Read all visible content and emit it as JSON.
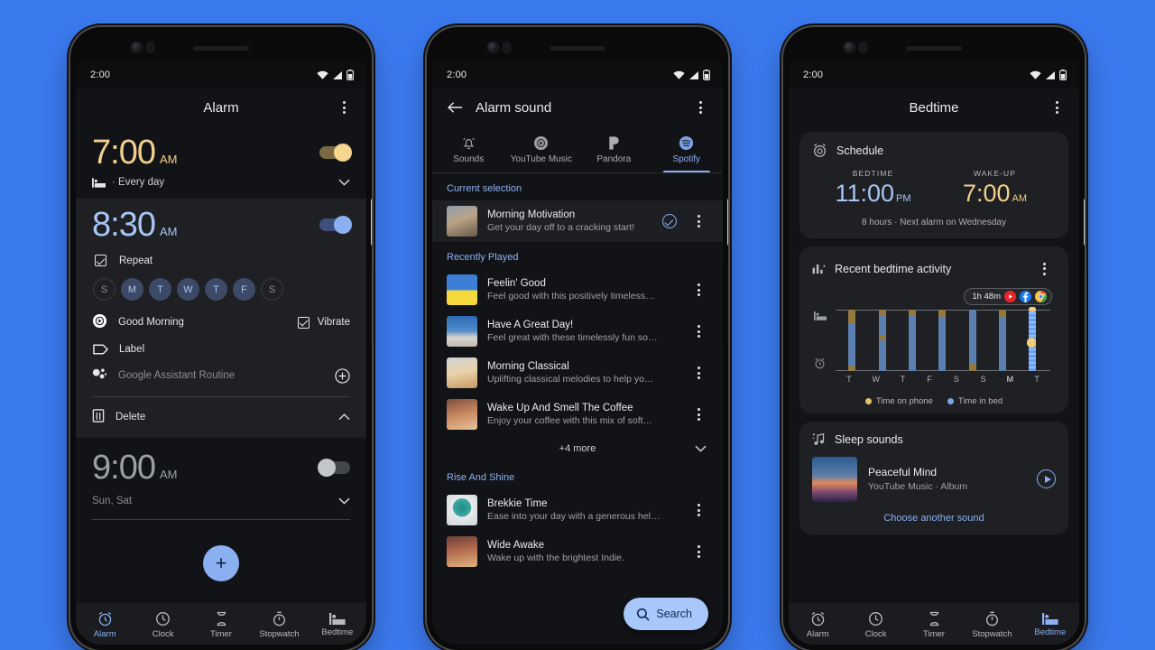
{
  "background_color": "#3b7bf0",
  "status_bar": {
    "time": "2:00",
    "icons": [
      "wifi-icon",
      "signal-icon",
      "battery-icon"
    ]
  },
  "phone1": {
    "appbar": {
      "title": "Alarm",
      "overflow": "overflow-menu-icon"
    },
    "alarms": [
      {
        "time": "7:00",
        "ampm": "AM",
        "enabled": true,
        "accent": "#f2d08c",
        "schedule_icon": "bed-icon",
        "schedule": "·  Every day",
        "expand": "chevron-down-icon"
      },
      {
        "time": "8:30",
        "ampm": "AM",
        "enabled": true,
        "accent": "#a7c5f5",
        "repeat_label": "Repeat",
        "days": [
          {
            "letter": "S",
            "on": false
          },
          {
            "letter": "M",
            "on": true
          },
          {
            "letter": "T",
            "on": true
          },
          {
            "letter": "W",
            "on": true
          },
          {
            "letter": "T",
            "on": true
          },
          {
            "letter": "F",
            "on": true
          },
          {
            "letter": "S",
            "on": false
          }
        ],
        "ringtone": "Good Morning",
        "vibrate_label": "Vibrate",
        "vibrate_on": true,
        "label_row": "Label",
        "assistant_row": "Google Assistant Routine",
        "assistant_add": "plus-circle-icon",
        "delete_label": "Delete",
        "collapse": "chevron-up-icon"
      },
      {
        "time": "9:00",
        "ampm": "AM",
        "enabled": false,
        "accent": "#9aa0a6",
        "schedule": "Sun, Sat",
        "expand": "chevron-down-icon"
      }
    ],
    "fab": "+",
    "nav": [
      {
        "label": "Alarm",
        "icon": "alarm-icon",
        "active": true
      },
      {
        "label": "Clock",
        "icon": "clock-icon",
        "active": false
      },
      {
        "label": "Timer",
        "icon": "hourglass-icon",
        "active": false
      },
      {
        "label": "Stopwatch",
        "icon": "stopwatch-icon",
        "active": false
      },
      {
        "label": "Bedtime",
        "icon": "bed-icon",
        "active": false
      }
    ]
  },
  "phone2": {
    "appbar": {
      "back": "back-arrow-icon",
      "title": "Alarm sound",
      "overflow": "overflow-menu-icon"
    },
    "tabs": [
      {
        "label": "Sounds",
        "icon": "bell-icon",
        "active": false
      },
      {
        "label": "YouTube Music",
        "icon": "youtube-music-icon",
        "active": false
      },
      {
        "label": "Pandora",
        "icon": "pandora-icon",
        "active": false
      },
      {
        "label": "Spotify",
        "icon": "spotify-icon",
        "active": true
      }
    ],
    "sections": [
      {
        "heading": "Current selection",
        "items": [
          {
            "title": "Morning Motivation",
            "desc": "Get your day off to a cracking start!",
            "selected": true,
            "art": "art-morning-motivation"
          }
        ]
      },
      {
        "heading": "Recently Played",
        "items": [
          {
            "title": "Feelin' Good",
            "desc": "Feel good with this positively timeless…",
            "art": "art-feelin-good"
          },
          {
            "title": "Have A Great Day!",
            "desc": "Feel great with these timelessly fun so…",
            "art": "art-have-a-great-day"
          },
          {
            "title": "Morning Classical",
            "desc": "Uplifting classical melodies to help yo…",
            "art": "art-morning-classical"
          },
          {
            "title": "Wake Up And Smell The Coffee",
            "desc": "Enjoy your coffee with this mix of soft…",
            "art": "art-wake-up-coffee"
          }
        ],
        "more": "+4 more"
      },
      {
        "heading": "Rise And Shine",
        "items": [
          {
            "title": "Brekkie Time",
            "desc": "Ease into your day with a generous hel…",
            "art": "art-brekkie-time"
          },
          {
            "title": "Wide Awake",
            "desc": "Wake up with the brightest Indie.",
            "art": "art-wide-awake"
          }
        ]
      }
    ],
    "search_fab": {
      "label": "Search",
      "icon": "search-icon"
    }
  },
  "phone3": {
    "appbar": {
      "title": "Bedtime",
      "overflow": "overflow-menu-icon"
    },
    "schedule": {
      "title": "Schedule",
      "icon": "alarm-icon",
      "bedtime_label": "BEDTIME",
      "bedtime_value": "11:00",
      "bedtime_ampm": "PM",
      "wake_label": "WAKE-UP",
      "wake_value": "7:00",
      "wake_ampm": "AM",
      "note": "8 hours · Next alarm on Wednesday"
    },
    "activity": {
      "title": "Recent bedtime activity",
      "icon": "bar-chart-icon",
      "overflow": "overflow-menu-icon",
      "badge": {
        "duration": "1h 48m",
        "apps": [
          "youtube-icon",
          "facebook-icon",
          "chrome-icon"
        ]
      }
    },
    "sleep_sounds": {
      "title": "Sleep  sounds",
      "icon": "music-note-icon",
      "track_title": "Peaceful Mind",
      "track_sub": "YouTube Music · Album",
      "play": "play-circle-icon",
      "choose": "Choose another sound"
    },
    "nav": [
      {
        "label": "Alarm",
        "icon": "alarm-icon",
        "active": false
      },
      {
        "label": "Clock",
        "icon": "clock-icon",
        "active": false
      },
      {
        "label": "Timer",
        "icon": "hourglass-icon",
        "active": false
      },
      {
        "label": "Stopwatch",
        "icon": "stopwatch-icon",
        "active": false
      },
      {
        "label": "Bedtime",
        "icon": "bed-icon",
        "active": true
      }
    ]
  },
  "chart_data": {
    "type": "bar",
    "title": "Recent bedtime activity",
    "categories": [
      "T",
      "W",
      "T",
      "F",
      "S",
      "S",
      "M",
      "T"
    ],
    "xlabel": "",
    "ylabel": "",
    "legend": [
      {
        "name": "Time on phone",
        "color": "#e8c16a"
      },
      {
        "name": "Time in bed",
        "color": "#7aa7e8"
      }
    ],
    "legend_position": "bottom-center",
    "grid": false,
    "note": "Vertical bars spanning bedtime (top) to wake-up (bottom); amber segments mark phone use.",
    "bars": [
      {
        "day": "T",
        "x_pct": 6,
        "in_bed_top_pct": 0,
        "in_bed_bottom_pct": 100,
        "phone_segments": [
          [
            0,
            22
          ],
          [
            92,
            100
          ]
        ]
      },
      {
        "day": "W",
        "x_pct": 20,
        "in_bed_top_pct": 3,
        "in_bed_bottom_pct": 100,
        "phone_segments": [
          [
            0,
            11
          ],
          [
            41,
            51
          ]
        ]
      },
      {
        "day": "T",
        "x_pct": 34,
        "in_bed_top_pct": 4,
        "in_bed_bottom_pct": 100,
        "phone_segments": [
          [
            0,
            9
          ]
        ]
      },
      {
        "day": "F",
        "x_pct": 48,
        "in_bed_top_pct": 3,
        "in_bed_bottom_pct": 100,
        "phone_segments": [
          [
            0,
            12
          ]
        ]
      },
      {
        "day": "S",
        "x_pct": 62,
        "in_bed_top_pct": 0,
        "in_bed_bottom_pct": 100,
        "phone_segments": [
          [
            88,
            100
          ]
        ]
      },
      {
        "day": "S",
        "x_pct": 76,
        "in_bed_top_pct": 3,
        "in_bed_bottom_pct": 100,
        "phone_segments": [
          [
            0,
            12
          ]
        ]
      },
      {
        "day": "M",
        "x_pct": 90,
        "in_bed_top_pct": 0,
        "in_bed_bottom_pct": 100,
        "current": true,
        "phone_segments": [
          [
            -3,
            6
          ],
          [
            46,
            62
          ]
        ]
      }
    ]
  }
}
